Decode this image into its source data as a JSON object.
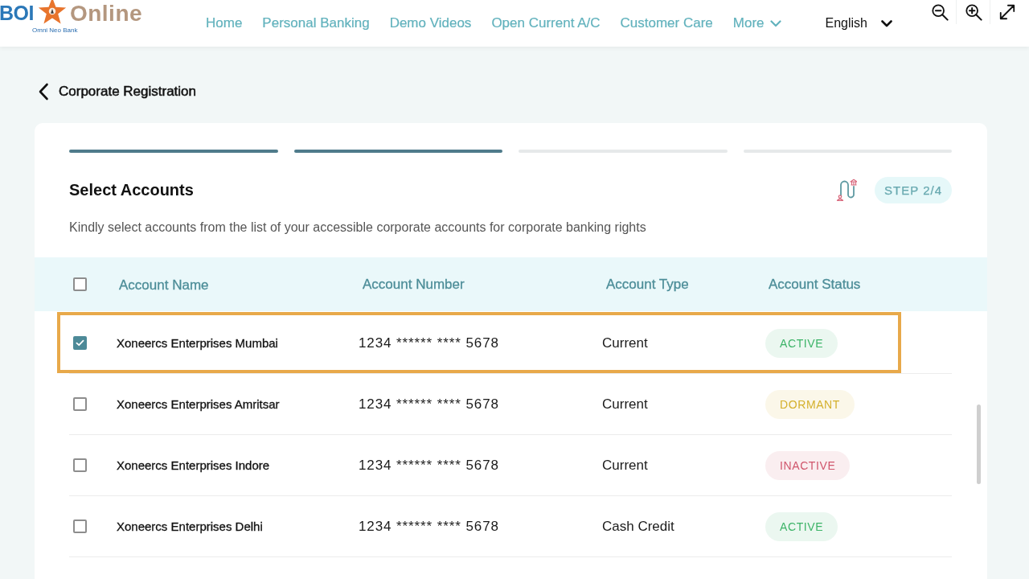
{
  "header": {
    "logo": {
      "brand": "BOI",
      "product": "Online",
      "tagline": "Omni Neo Bank"
    },
    "nav": [
      {
        "label": "Home",
        "dropdown": false
      },
      {
        "label": "Personal Banking",
        "dropdown": false
      },
      {
        "label": "Demo Videos",
        "dropdown": false
      },
      {
        "label": "Open Current A/C",
        "dropdown": false
      },
      {
        "label": "Customer Care",
        "dropdown": false
      },
      {
        "label": "More",
        "dropdown": true
      }
    ],
    "language": {
      "value": "English"
    }
  },
  "page": {
    "title": "Corporate Registration"
  },
  "wizard": {
    "steps": [
      {
        "done": true
      },
      {
        "done": true
      },
      {
        "done": false
      },
      {
        "done": false
      }
    ],
    "title": "Select Accounts",
    "step_badge": "STEP 2/4",
    "description": "Kindly select accounts from the list of your accessible corporate accounts for corporate banking rights"
  },
  "table": {
    "select_all": {
      "checked": false
    },
    "columns": [
      "Account Name",
      "Account Number",
      "Account Type",
      "Account Status"
    ],
    "rows": [
      {
        "name": "Xoneercs Enterprises Mumbai",
        "number": "1234 ****** **** 5678",
        "type": "Current",
        "status": "ACTIVE",
        "color": "#3db468",
        "checked": true,
        "highlighted": true
      },
      {
        "name": "Xoneercs Enterprises Amritsar",
        "number": "1234 ****** **** 5678",
        "type": "Current",
        "status": "DORMANT",
        "color": "#d4b02c",
        "checked": false,
        "highlighted": false
      },
      {
        "name": "Xoneercs Enterprises Indore",
        "number": "1234 ****** **** 5678",
        "type": "Current",
        "status": "INACTIVE",
        "color": "#d0566c",
        "checked": false,
        "highlighted": false
      },
      {
        "name": "Xoneercs Enterprises Delhi",
        "number": "1234 ****** **** 5678",
        "type": "Cash Credit",
        "status": "ACTIVE",
        "color": "#3db468",
        "checked": false,
        "highlighted": false
      }
    ]
  }
}
